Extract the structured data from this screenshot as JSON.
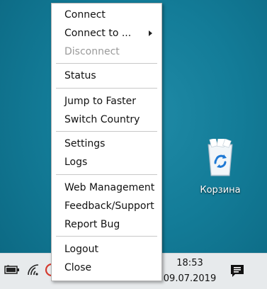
{
  "menu": {
    "items": [
      {
        "label": "Connect",
        "enabled": true
      },
      {
        "label": "Connect to ...",
        "enabled": true,
        "submenu": true
      },
      {
        "label": "Disconnect",
        "enabled": false
      },
      {
        "label": "Status",
        "enabled": true
      },
      {
        "label": "Jump to Faster",
        "enabled": true
      },
      {
        "label": "Switch Country",
        "enabled": true
      },
      {
        "label": "Settings",
        "enabled": true
      },
      {
        "label": "Logs",
        "enabled": true
      },
      {
        "label": "Web Management",
        "enabled": true
      },
      {
        "label": "Feedback/Support",
        "enabled": true
      },
      {
        "label": "Report Bug",
        "enabled": true
      },
      {
        "label": "Logout",
        "enabled": true
      },
      {
        "label": "Close",
        "enabled": true
      }
    ]
  },
  "desktop": {
    "recycle_bin_label": "Корзина"
  },
  "taskbar": {
    "time": "18:53",
    "date": "09.07.2019"
  },
  "colors": {
    "desktop": "#137c98",
    "taskbar": "#e7eaec",
    "menu_bg": "#ffffff",
    "disabled_text": "#9a9a9a"
  }
}
